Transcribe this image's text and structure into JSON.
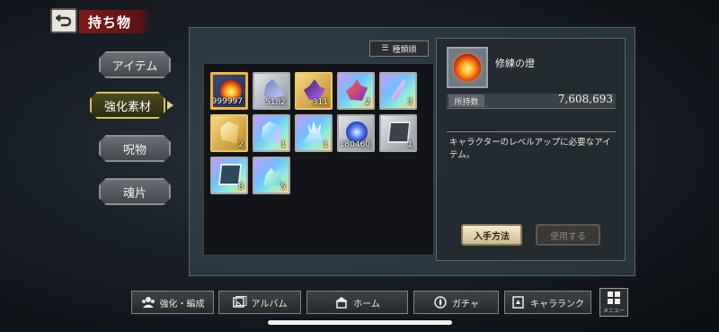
{
  "header": {
    "title": "持ち物"
  },
  "categories": [
    {
      "label": "アイテム",
      "active": false
    },
    {
      "label": "強化素材",
      "active": true
    },
    {
      "label": "呪物",
      "active": false
    },
    {
      "label": "魂片",
      "active": false
    }
  ],
  "toolbar": {
    "sort_label": "種類順"
  },
  "items": [
    {
      "count": "999997",
      "rarity": "orange",
      "icon": "flame-orb-icon"
    },
    {
      "count": "5182",
      "rarity": "silver",
      "icon": "crystal-shard-icon"
    },
    {
      "count": "311",
      "rarity": "gold",
      "icon": "dark-crystal-icon"
    },
    {
      "count": "2",
      "rarity": "rainbow",
      "icon": "fire-crystal-icon"
    },
    {
      "count": "3",
      "rarity": "rainbow",
      "icon": "feather-shard-icon"
    },
    {
      "count": "2",
      "rarity": "gold",
      "icon": "gold-shard-icon"
    },
    {
      "count": "1",
      "rarity": "rainbow",
      "icon": "rainbow-gem-icon"
    },
    {
      "count": "1",
      "rarity": "rainbow",
      "icon": "crystal-cluster-icon"
    },
    {
      "count": "180460",
      "rarity": "silver",
      "icon": "blue-orb-icon"
    },
    {
      "count": "1",
      "rarity": "silver",
      "icon": "mirror-card-icon"
    },
    {
      "count": "8",
      "rarity": "rainbow",
      "icon": "mirror-card-icon"
    },
    {
      "count": "5",
      "rarity": "rainbow",
      "icon": "crystal-pile-icon"
    }
  ],
  "detail": {
    "name": "修練の燈",
    "owned_label": "所持数",
    "owned_value": "7,608,693",
    "description": "キャラクターのレベルアップに必要なアイテム。",
    "acquire_label": "入手方法",
    "use_label": "使用する"
  },
  "nav": [
    {
      "label": "強化・編成",
      "icon": "team-icon"
    },
    {
      "label": "アルバム",
      "icon": "album-icon"
    },
    {
      "label": "ホーム",
      "icon": "home-icon"
    },
    {
      "label": "ガチャ",
      "icon": "gacha-icon"
    },
    {
      "label": "キャラランク",
      "icon": "rank-icon"
    }
  ],
  "menu": {
    "label": "メニュー"
  },
  "colors": {
    "title_bg": "#7d1b1b",
    "active_border": "#d6c45a",
    "selected_item_border": "#f2b231"
  }
}
